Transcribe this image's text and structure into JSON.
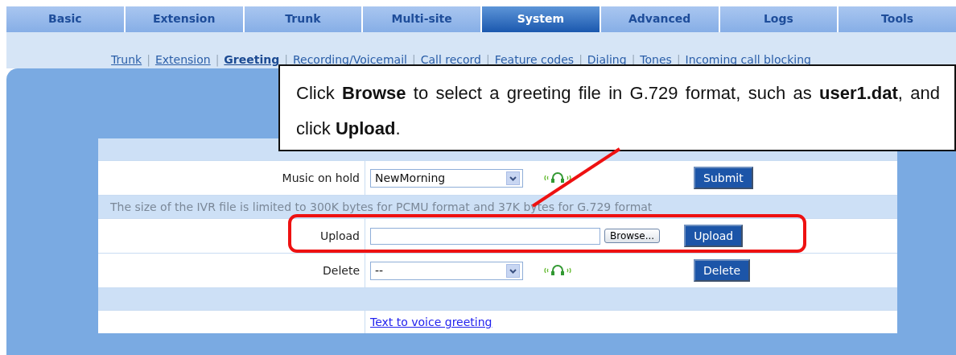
{
  "tabs": [
    {
      "label": "Basic",
      "selected": false
    },
    {
      "label": "Extension",
      "selected": false
    },
    {
      "label": "Trunk",
      "selected": false
    },
    {
      "label": "Multi-site",
      "selected": false
    },
    {
      "label": "System",
      "selected": true
    },
    {
      "label": "Advanced",
      "selected": false
    },
    {
      "label": "Logs",
      "selected": false
    },
    {
      "label": "Tools",
      "selected": false
    }
  ],
  "subnav": [
    {
      "label": "Trunk",
      "selected": false
    },
    {
      "separator": "|",
      "label": "Extension",
      "selected": false
    },
    {
      "separator": "|",
      "label": "Greeting",
      "selected": true
    },
    {
      "separator": "|",
      "label": "Recording/Voicemail",
      "selected": false
    },
    {
      "separator": "|",
      "label": "Call record",
      "selected": false
    },
    {
      "separator": "|",
      "label": "Feature codes",
      "selected": false
    },
    {
      "separator": "|",
      "label": "Dialing",
      "selected": false
    },
    {
      "separator": "|",
      "label": "Tones",
      "selected": false
    },
    {
      "separator": "|",
      "label": "Incoming call blocking",
      "selected": false
    }
  ],
  "rows": [
    {
      "kind": "band"
    },
    {
      "kind": "select",
      "label": "Music on hold",
      "value": "NewMorning",
      "button": "Submit"
    },
    {
      "kind": "note",
      "text": "The size of the IVR file is limited to 300K bytes for PCMU format and 37K bytes for G.729 format"
    },
    {
      "kind": "upload",
      "label": "Upload",
      "browse": "Browse...",
      "button": "Upload"
    },
    {
      "kind": "select",
      "label": "Delete",
      "value": "--",
      "button": "Delete"
    },
    {
      "kind": "band"
    },
    {
      "kind": "link",
      "text": "Text to voice greeting"
    }
  ],
  "callout": {
    "text": "Click **Browse** to select a greeting file in G.729 format, such as **user1.dat**, and click **Upload**."
  }
}
